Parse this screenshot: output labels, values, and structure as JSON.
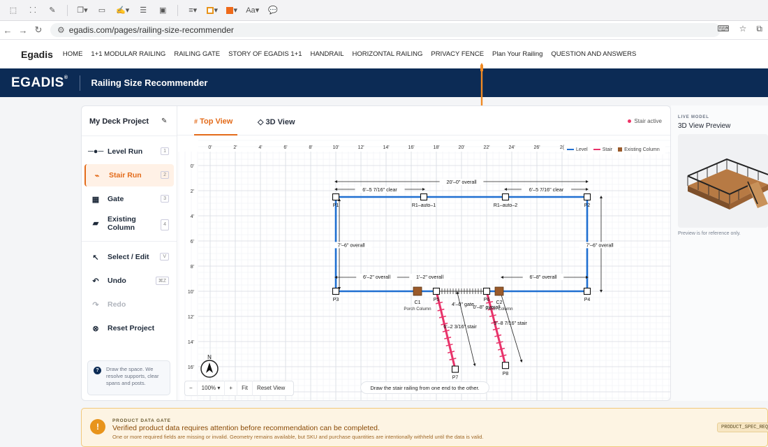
{
  "browser": {
    "url": "egadis.com/pages/railing-size-recommender",
    "toolbar_font_label": "Aa"
  },
  "site_nav": {
    "logo": "Egadis",
    "links": [
      "HOME",
      "1+1 MODULAR RAILING",
      "RAILING GATE",
      "STORY OF EGADIS 1+1",
      "HANDRAIL",
      "HORIZONTAL RAILING",
      "PRIVACY FENCE",
      "Plan Your Railing",
      "QUESTION AND ANSWERS"
    ]
  },
  "hero": {
    "brand": "EGADIS",
    "title": "Railing Size Recommender"
  },
  "sidebar": {
    "project": "My Deck Project",
    "tools": [
      {
        "label": "Level Run",
        "key": "1"
      },
      {
        "label": "Stair Run",
        "key": "2"
      },
      {
        "label": "Gate",
        "key": "3"
      },
      {
        "label": "Existing Column",
        "key": "4"
      },
      {
        "label": "Select / Edit",
        "key": "V"
      },
      {
        "label": "Undo",
        "key": "⌘Z"
      },
      {
        "label": "Redo",
        "key": ""
      },
      {
        "label": "Reset Project",
        "key": ""
      }
    ],
    "hint": "Draw the space. We resolve supports, clear spans and posts."
  },
  "tabs": {
    "top": "Top View",
    "three_d": "3D View",
    "status": "Stair active"
  },
  "canvas": {
    "legend": [
      "Level",
      "Stair",
      "Existing Column"
    ],
    "x_ticks": [
      "0'",
      "2'",
      "4'",
      "6'",
      "8'",
      "10'",
      "12'",
      "14'",
      "16'",
      "18'",
      "20'",
      "22'",
      "24'",
      "26'",
      "2("
    ],
    "y_ticks": [
      "0'",
      "2'",
      "4'",
      "6'",
      "8'",
      "10'",
      "12'",
      "14'",
      "16'"
    ],
    "compass": "N",
    "labels": {
      "overall_top": "20'–0\" overall",
      "clear_left": "6'–5 7/16\" clear",
      "clear_right": "6'–5 7/16\" clear",
      "left_side": "7'–6\" overall",
      "right_side": "7'–6\" overall",
      "bottom_left": "6'–2\" overall",
      "bottom_mid": "1'–2\" overall",
      "bottom_right": "6'–8\" overall",
      "gate": "4'–0\" gate",
      "mid_small": "0'–8\" overall",
      "stair_left": "6'–2 3/16\" stair",
      "stair_right": "5'–8 7/16\" stair",
      "porch_column": "Porch Column",
      "porch_column2": "Porch Column"
    },
    "points": {
      "p1": "P1",
      "p2": "P2",
      "p3": "P3",
      "p4": "P4",
      "p5": "P5",
      "p6": "P6",
      "p7": "P7",
      "p8": "P8",
      "r1": "R1–auto–1",
      "r2": "R1–auto–2",
      "c1": "C1",
      "c2": "C2"
    },
    "zoom": {
      "minus": "−",
      "level": "100%",
      "plus": "+",
      "fit": "Fit",
      "reset": "Reset View"
    },
    "toast": "Draw the stair railing from one end to the other."
  },
  "preview": {
    "label": "LIVE MODEL",
    "title": "3D View Preview",
    "note": "Preview is for reference only."
  },
  "banner": {
    "label": "PRODUCT DATA GATE",
    "message": "Verified product data requires attention before recommendation can be completed.",
    "sub": "One or more required fields are missing or invalid. Geometry remains available, but SKU and purchase quantities are intentionally withheld until the data is valid.",
    "code": "PRODUCT_SPEC_REQ"
  },
  "colors": {
    "level": "#1f6fd1",
    "stair": "#e8336a",
    "column": "#9a5a2a",
    "accent": "#e36b1a",
    "navy": "#0c2b55"
  }
}
